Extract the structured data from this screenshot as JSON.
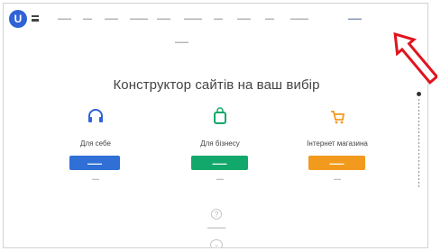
{
  "header": {
    "logo_letter": "U",
    "nav_items": [
      "",
      "",
      "",
      "",
      "",
      "",
      "",
      "",
      "",
      "",
      ""
    ],
    "nav_sub": ""
  },
  "hero": {
    "title": "Конструктор сайтів на ваш вибір"
  },
  "cards": [
    {
      "icon": "headphones-icon",
      "label": "Для себе",
      "button": "",
      "note": "",
      "color": "#2f6fd6"
    },
    {
      "icon": "shopping-bag-icon",
      "label": "Для бізнесу",
      "button": "",
      "note": "",
      "color": "#13a86b"
    },
    {
      "icon": "cart-icon",
      "label": "Інтернет магазина",
      "button": "",
      "note": "",
      "color": "#f29a1d"
    }
  ],
  "footer": {
    "help_symbol": "?",
    "help_text": "",
    "scroll_symbol": "⌄"
  },
  "colors": {
    "brand": "#2f63d6",
    "annotation_arrow": "#e0141e"
  }
}
